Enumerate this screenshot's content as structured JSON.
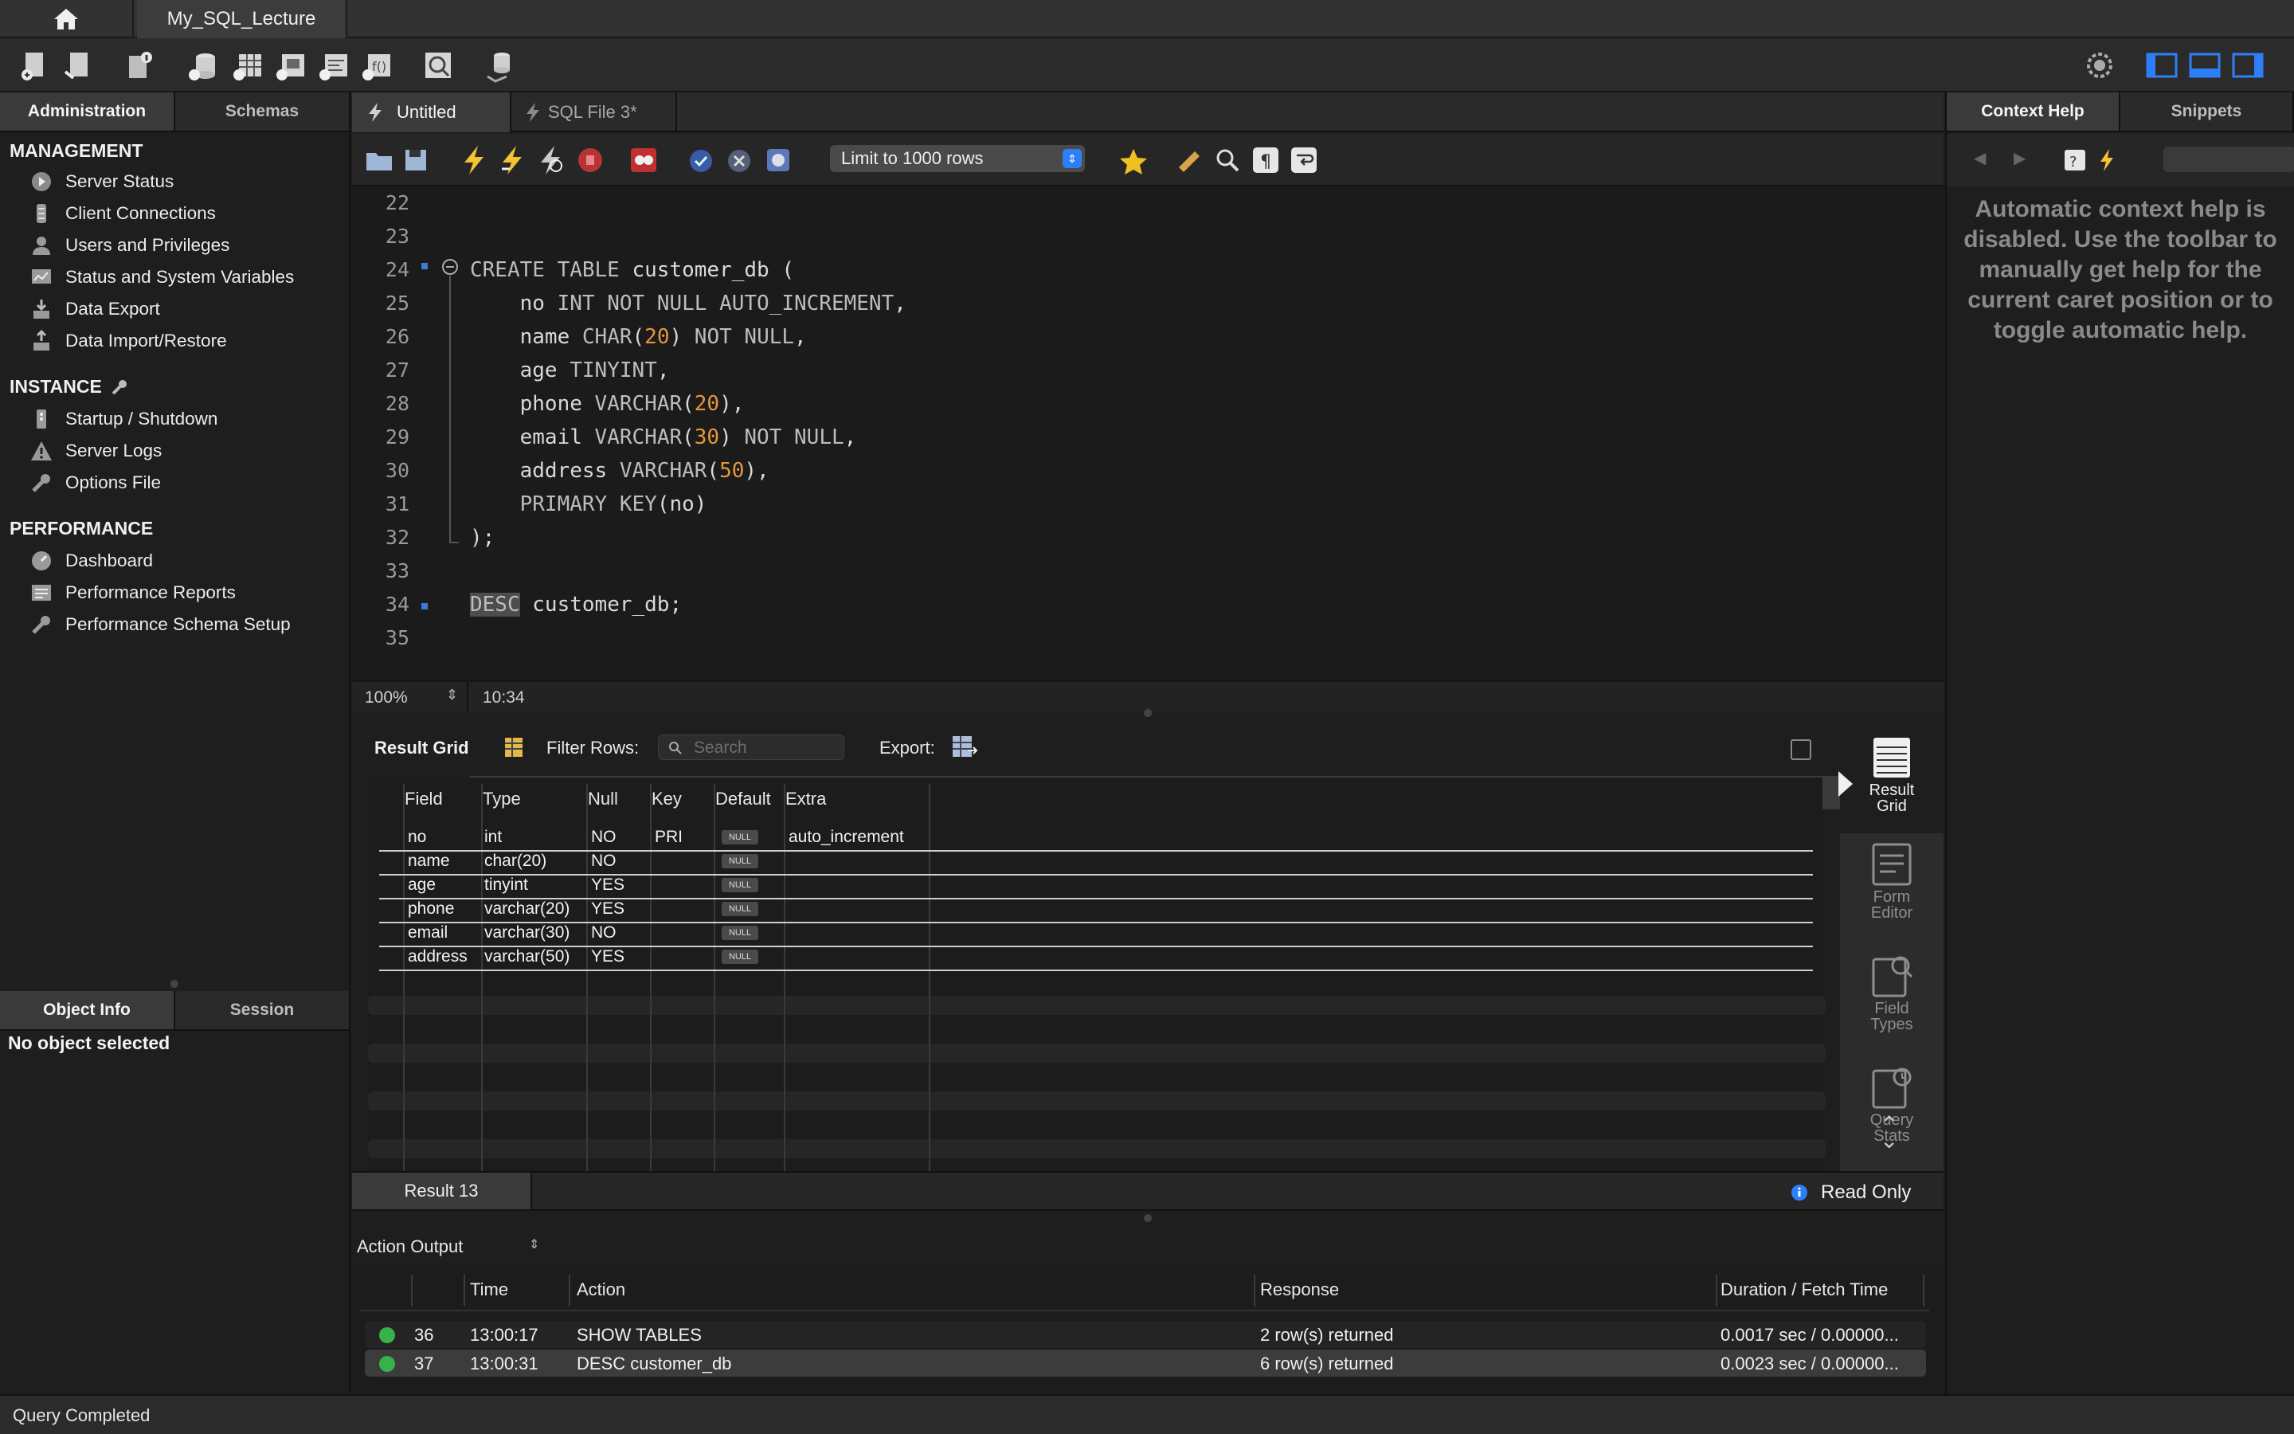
{
  "tabs": {
    "connection": "My_SQL_Lecture"
  },
  "sidebar": {
    "tabs": [
      "Administration",
      "Schemas"
    ],
    "management": {
      "title": "MANAGEMENT",
      "items": [
        "Server Status",
        "Client Connections",
        "Users and Privileges",
        "Status and System Variables",
        "Data Export",
        "Data Import/Restore"
      ]
    },
    "instance": {
      "title": "INSTANCE",
      "items": [
        "Startup / Shutdown",
        "Server Logs",
        "Options File"
      ]
    },
    "performance": {
      "title": "PERFORMANCE",
      "items": [
        "Dashboard",
        "Performance Reports",
        "Performance Schema Setup"
      ]
    },
    "bottom_tabs": [
      "Object Info",
      "Session"
    ],
    "object_info": "No object selected"
  },
  "editor": {
    "tabs": [
      "Untitled",
      "SQL File 3*"
    ],
    "limit": "Limit to 1000 rows",
    "line_numbers": [
      "22",
      "23",
      "24",
      "25",
      "26",
      "27",
      "28",
      "29",
      "30",
      "31",
      "32",
      "33",
      "34",
      "35"
    ],
    "zoom": "100%",
    "cursor": "10:34"
  },
  "result": {
    "title": "Result Grid",
    "filter_label": "Filter Rows:",
    "search_placeholder": "Search",
    "export_label": "Export:",
    "columns": [
      "Field",
      "Type",
      "Null",
      "Key",
      "Default",
      "Extra"
    ],
    "rows": [
      {
        "field": "no",
        "type": "int",
        "null": "NO",
        "key": "PRI",
        "default": "NULL",
        "extra": "auto_increment"
      },
      {
        "field": "name",
        "type": "char(20)",
        "null": "NO",
        "key": "",
        "default": "NULL",
        "extra": ""
      },
      {
        "field": "age",
        "type": "tinyint",
        "null": "YES",
        "key": "",
        "default": "NULL",
        "extra": ""
      },
      {
        "field": "phone",
        "type": "varchar(20)",
        "null": "YES",
        "key": "",
        "default": "NULL",
        "extra": ""
      },
      {
        "field": "email",
        "type": "varchar(30)",
        "null": "NO",
        "key": "",
        "default": "NULL",
        "extra": ""
      },
      {
        "field": "address",
        "type": "varchar(50)",
        "null": "YES",
        "key": "",
        "default": "NULL",
        "extra": ""
      }
    ],
    "tab": "Result 13",
    "read_only": "Read Only",
    "rail": {
      "result_grid": "Result\nGrid",
      "form_editor": "Form\nEditor",
      "field_types": "Field\nTypes",
      "query_stats": "Query\nStats"
    }
  },
  "output": {
    "selector": "Action Output",
    "columns": [
      "Time",
      "Action",
      "Response",
      "Duration / Fetch Time"
    ],
    "rows": [
      {
        "n": "36",
        "time": "13:00:17",
        "action": "SHOW TABLES",
        "response": "2 row(s) returned",
        "duration": "0.0017 sec / 0.00000..."
      },
      {
        "n": "37",
        "time": "13:00:31",
        "action": "DESC customer_db",
        "response": "6 row(s) returned",
        "duration": "0.0023 sec / 0.00000..."
      }
    ]
  },
  "right_panel": {
    "tabs": [
      "Context Help",
      "Snippets"
    ],
    "help_text": "Automatic context help is disabled. Use the toolbar to manually get help for the current caret position or to toggle automatic help."
  },
  "status": "Query Completed",
  "colors": {
    "accent": "#2d7ff9",
    "number": "#e6963c",
    "ok": "#36b24a"
  }
}
